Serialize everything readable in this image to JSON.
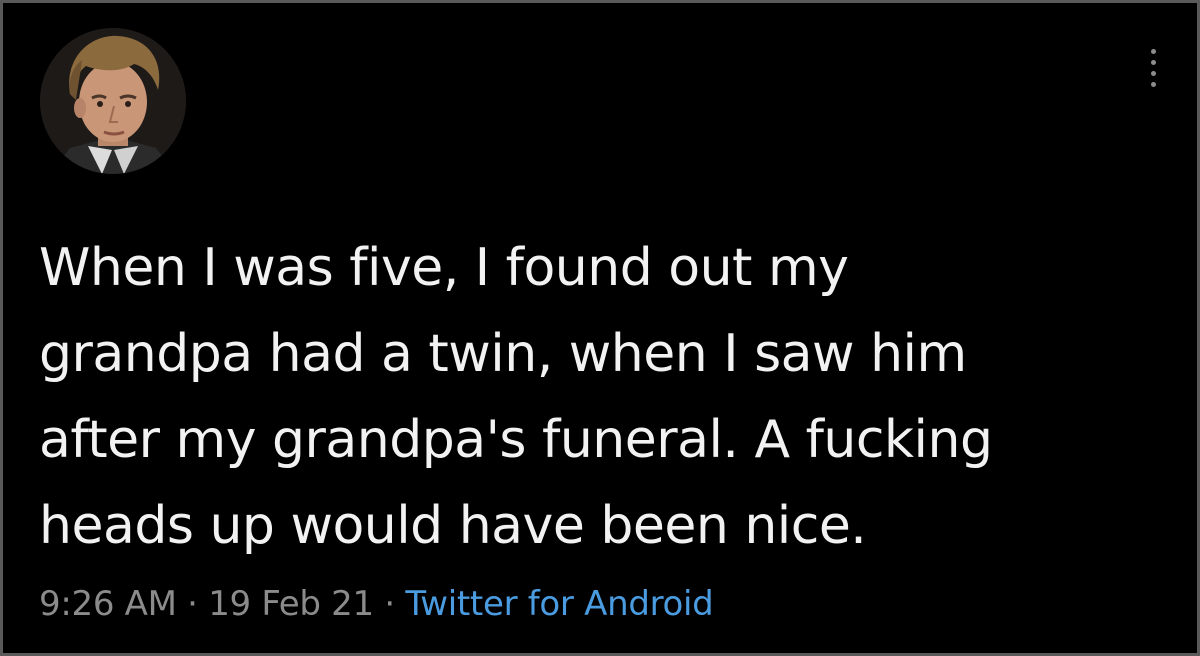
{
  "tweet": {
    "avatar_icon": "user-avatar-photo",
    "more_icon": "vertical-ellipsis-icon",
    "text_lines": [
      "When I was five, I found out my",
      "grandpa had a twin, when I saw him",
      "after my grandpa's funeral. A fucking",
      "heads up would have been nice."
    ],
    "time": "9:26 AM",
    "separator": "·",
    "date": "19 Feb 21",
    "source": "Twitter for Android",
    "colors": {
      "background": "#000000",
      "text": "#f2f2f2",
      "muted": "#8b8b8b",
      "link": "#4a9be0"
    }
  }
}
